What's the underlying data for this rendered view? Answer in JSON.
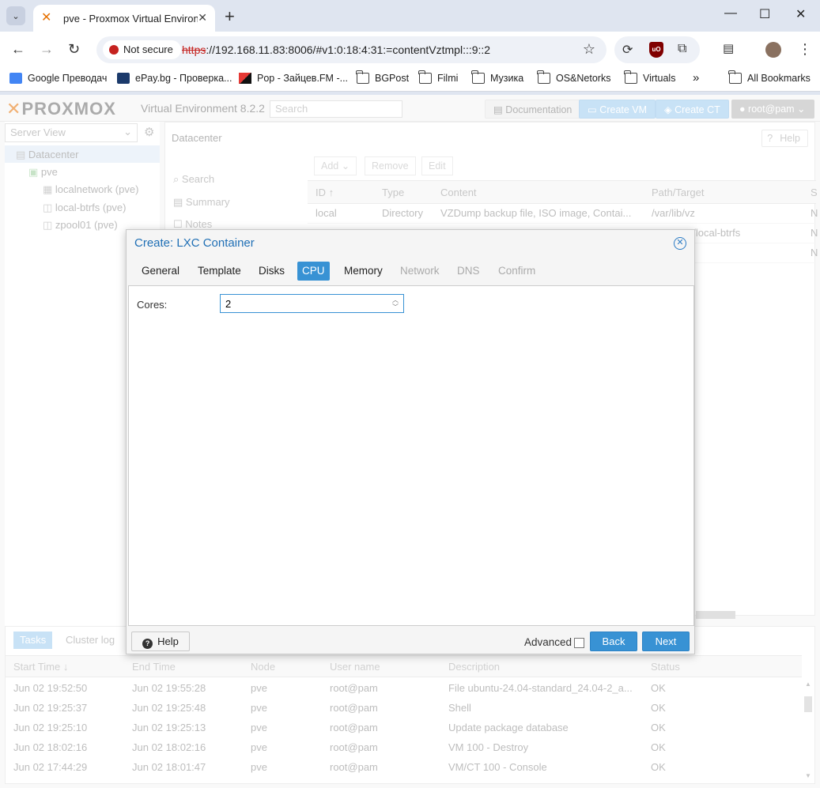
{
  "browser": {
    "tab_title": "pve - Proxmox Virtual Environme",
    "security_label": "Not secure",
    "url_scheme": "https",
    "url_rest": "://192.168.11.83:8006/#v1:0:18:4:31:=contentVztmpl:::9::2",
    "bookmarks": [
      {
        "label": "Google Преводач"
      },
      {
        "label": "ePay.bg - Проверка..."
      },
      {
        "label": "Pop - Зайцев.FM -..."
      },
      {
        "label": "BGPost"
      },
      {
        "label": "Filmi"
      },
      {
        "label": "Музика"
      },
      {
        "label": "OS&Netorks"
      },
      {
        "label": "Virtuals"
      }
    ],
    "more_bookmarks": "»",
    "all_bookmarks": "All Bookmarks"
  },
  "pve": {
    "logo_text": "PROXMOX",
    "version": "Virtual Environment 8.2.2",
    "search_placeholder": "Search",
    "documentation": "Documentation",
    "create_vm": "Create VM",
    "create_ct": "Create CT",
    "user": "root@pam",
    "server_view": "Server View",
    "tree": {
      "datacenter": "Datacenter",
      "node": "pve",
      "storages": [
        "localnetwork (pve)",
        "local-btrfs (pve)",
        "zpool01 (pve)"
      ]
    },
    "content": {
      "title": "Datacenter",
      "help": "Help",
      "nav": [
        "Search",
        "Summary",
        "Notes"
      ],
      "toolbar": {
        "add": "Add",
        "remove": "Remove",
        "edit": "Edit"
      },
      "columns": [
        "ID ↑",
        "Type",
        "Content",
        "Path/Target",
        "S"
      ],
      "rows": [
        {
          "id": "local",
          "type": "Directory",
          "content": "VZDump backup file, ISO image, Contai...",
          "path": "/var/lib/vz",
          "s": "N"
        },
        {
          "id": "",
          "type": "",
          "content": "",
          "path": "e/local-btrfs",
          "s": "N"
        },
        {
          "id": "",
          "type": "",
          "content": "",
          "path": "",
          "s": "N"
        }
      ]
    },
    "tasks": {
      "tabs": [
        "Tasks",
        "Cluster log"
      ],
      "columns": [
        "Start Time ↓",
        "End Time",
        "Node",
        "User name",
        "Description",
        "Status"
      ],
      "rows": [
        {
          "start": "Jun 02 19:52:50",
          "end": "Jun 02 19:55:28",
          "node": "pve",
          "user": "root@pam",
          "desc": "File ubuntu-24.04-standard_24.04-2_a...",
          "status": "OK"
        },
        {
          "start": "Jun 02 19:25:37",
          "end": "Jun 02 19:25:48",
          "node": "pve",
          "user": "root@pam",
          "desc": "Shell",
          "status": "OK"
        },
        {
          "start": "Jun 02 19:25:10",
          "end": "Jun 02 19:25:13",
          "node": "pve",
          "user": "root@pam",
          "desc": "Update package database",
          "status": "OK"
        },
        {
          "start": "Jun 02 18:02:16",
          "end": "Jun 02 18:02:16",
          "node": "pve",
          "user": "root@pam",
          "desc": "VM 100 - Destroy",
          "status": "OK"
        },
        {
          "start": "Jun 02 17:44:29",
          "end": "Jun 02 18:01:47",
          "node": "pve",
          "user": "root@pam",
          "desc": "VM/CT 100 - Console",
          "status": "OK"
        }
      ]
    }
  },
  "modal": {
    "title": "Create: LXC Container",
    "tabs": [
      {
        "label": "General"
      },
      {
        "label": "Template"
      },
      {
        "label": "Disks"
      },
      {
        "label": "CPU"
      },
      {
        "label": "Memory"
      },
      {
        "label": "Network"
      },
      {
        "label": "DNS"
      },
      {
        "label": "Confirm"
      }
    ],
    "cores_label": "Cores:",
    "cores_value": "2",
    "help": "Help",
    "advanced": "Advanced",
    "back": "Back",
    "next": "Next"
  },
  "colors": {
    "accent": "#3892d4",
    "brand_orange": "#e57000",
    "title_blue": "#1f6fb5"
  }
}
